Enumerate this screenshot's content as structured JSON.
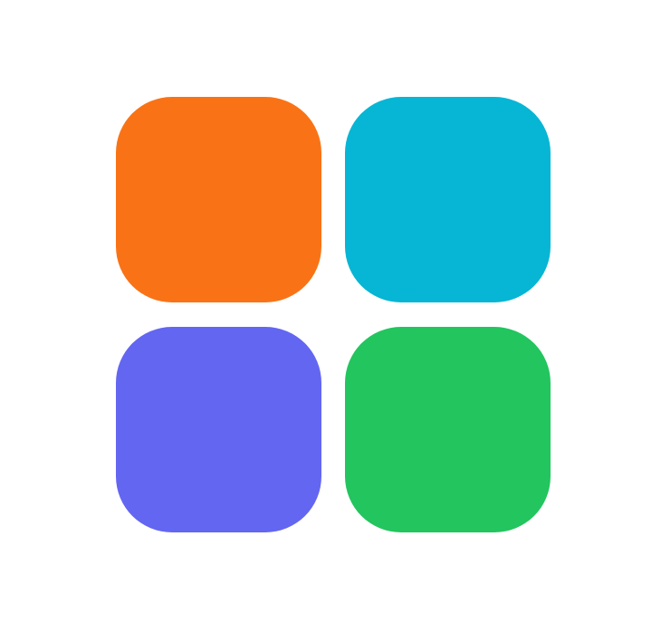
{
  "icon": {
    "name": "app-grid-icon",
    "tiles": [
      {
        "name": "orange-tile",
        "color": "#F97316"
      },
      {
        "name": "cyan-tile",
        "color": "#06B6D4"
      },
      {
        "name": "indigo-tile",
        "color": "#6366F1"
      },
      {
        "name": "green-tile",
        "color": "#22C55E"
      }
    ]
  }
}
